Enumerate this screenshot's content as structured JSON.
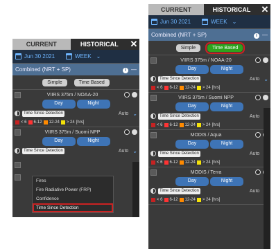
{
  "tabs": {
    "current": "CURRENT",
    "historical": "HISTORICAL",
    "close": "✕"
  },
  "date": "Jun 30 2021",
  "range": "WEEK",
  "layer_group": "Combined (NRT + SP)",
  "mode": {
    "simple": "Simple",
    "time_based": "Time Based"
  },
  "day": "Day",
  "night": "Night",
  "auto": "Auto",
  "legend": {
    "a": "< 6",
    "b": "6-12",
    "c": "12-24",
    "d": "> 24",
    "unit": "[hrs]"
  },
  "colors": {
    "lt6": "#c62222",
    "b6_12": "#ff3333",
    "b12_24": "#ff8a00",
    "gt24": "#f4e10a"
  },
  "selector_value": "Time Since Detection",
  "dropdown_options": [
    "Fires",
    "Fire Radiative Power (FRP)",
    "Confidence",
    "Time Since Detection"
  ],
  "left_layers": [
    "VIIRS 375m / NOAA-20",
    "VIIRS 375m / Suomi NPP"
  ],
  "right_layers": [
    "VIIRS 375m / NOAA-20",
    "VIIRS 375m / Suomi NPP",
    "MODIS / Aqua",
    "MODIS / Terra"
  ]
}
